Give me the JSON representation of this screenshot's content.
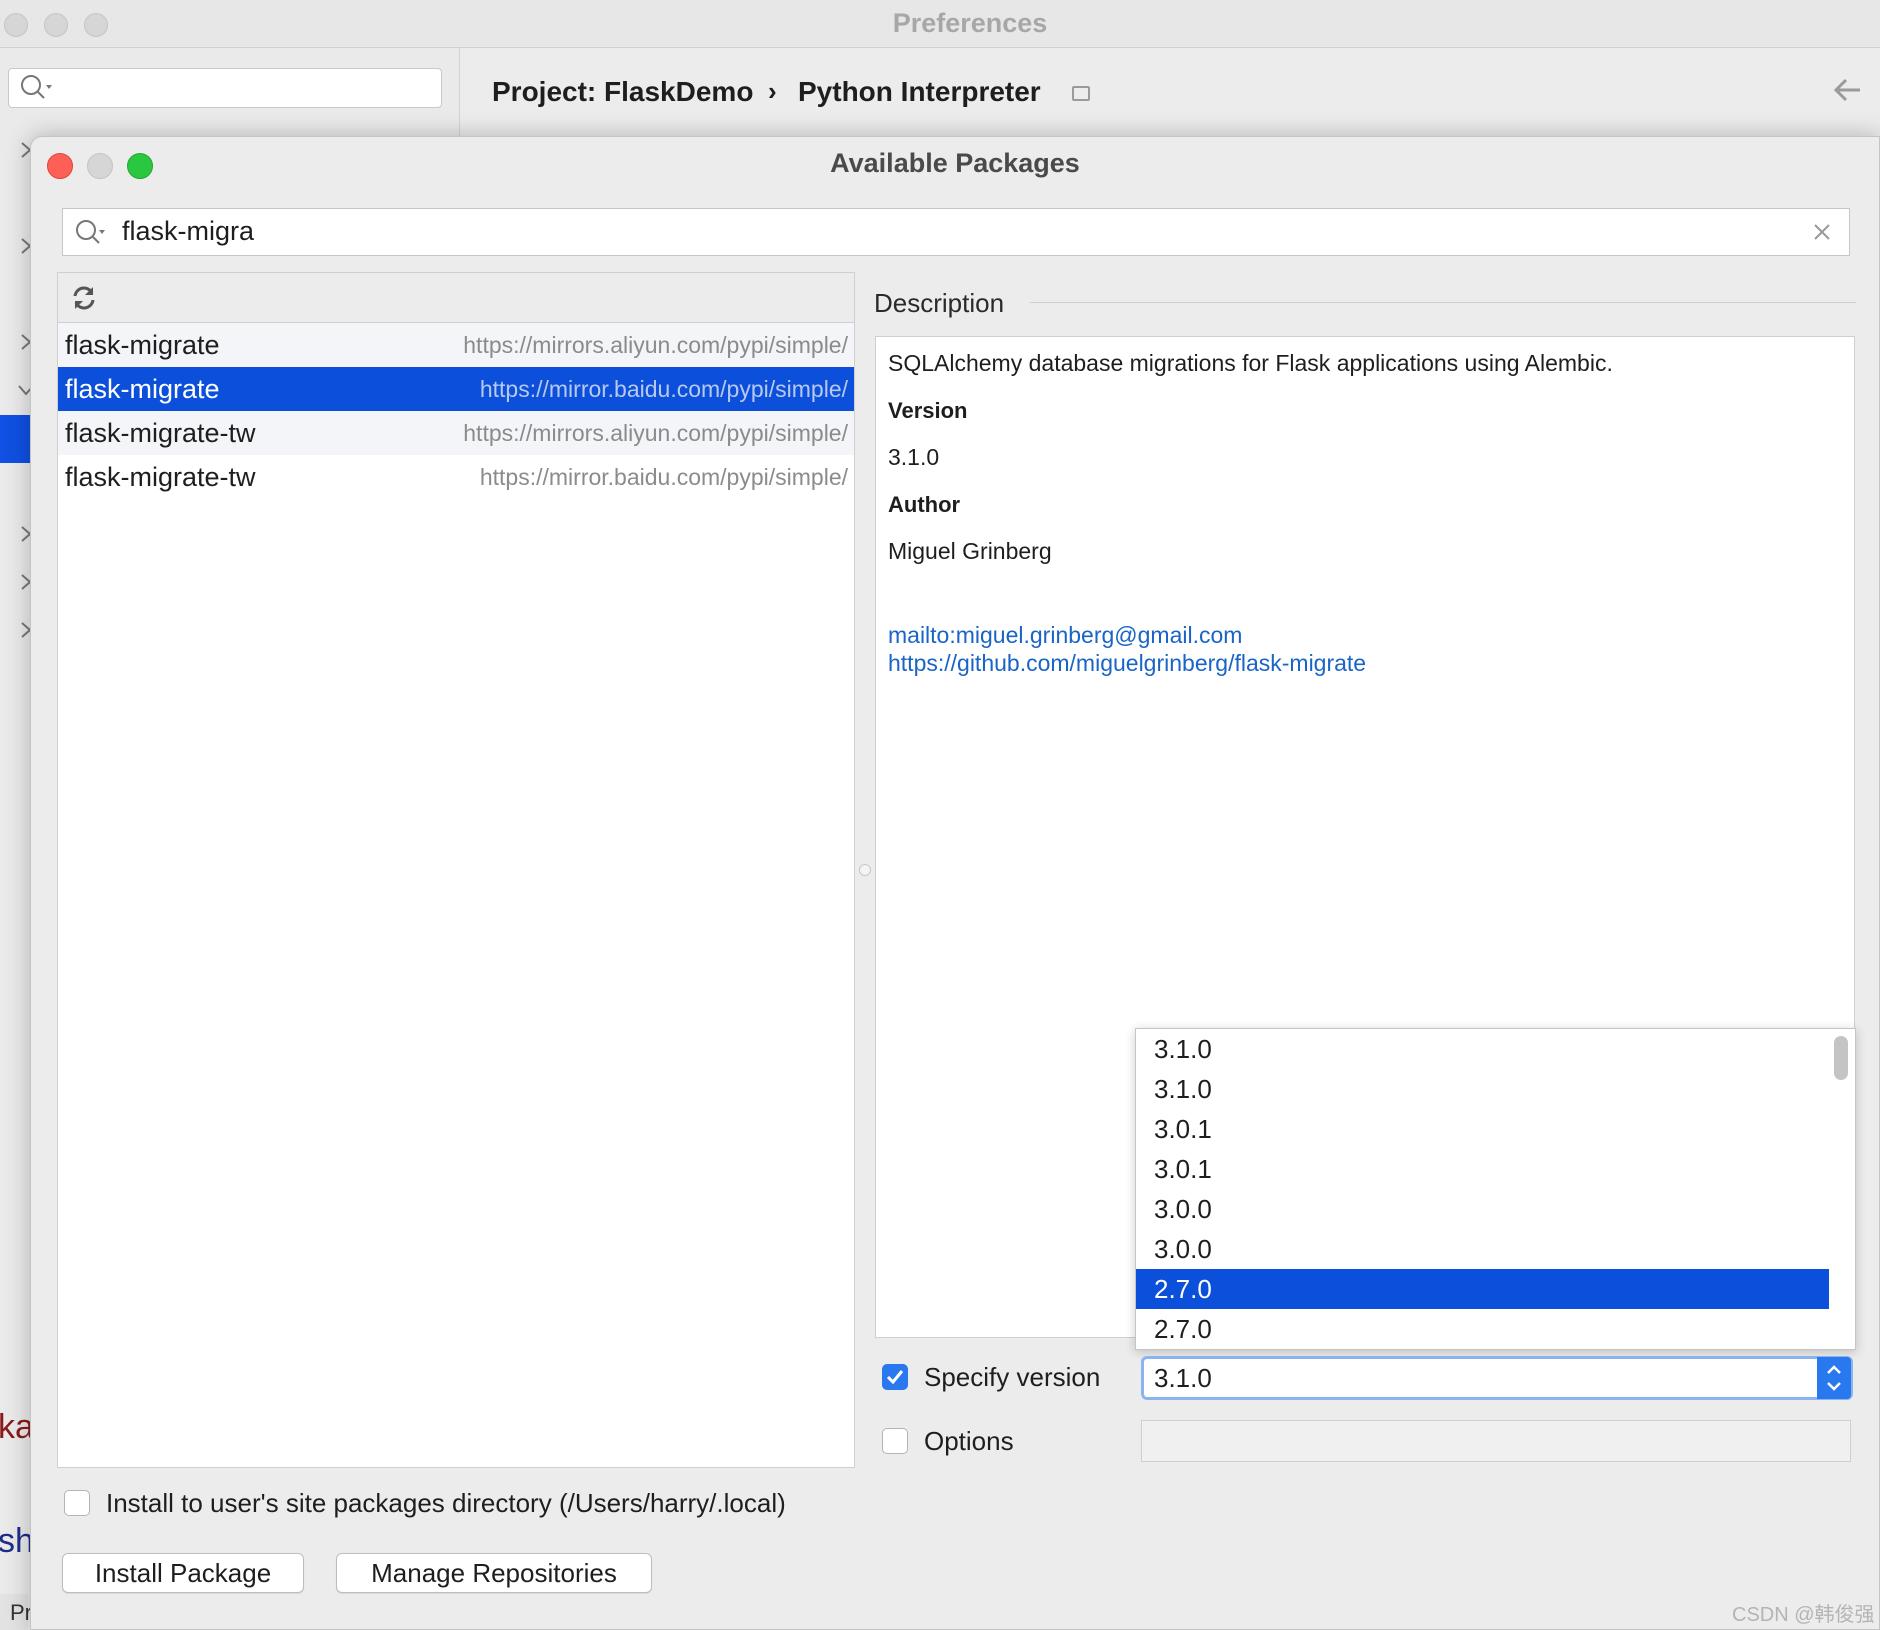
{
  "preferences": {
    "title": "Preferences",
    "breadcrumb_project": "Project: FlaskDemo",
    "breadcrumb_separator": "›",
    "breadcrumb_page": "Python Interpreter"
  },
  "dialog": {
    "title": "Available Packages",
    "search_value": "flask-migra"
  },
  "packages": [
    {
      "name": "flask-migrate",
      "url": "https://mirrors.aliyun.com/pypi/simple/"
    },
    {
      "name": "flask-migrate",
      "url": "https://mirror.baidu.com/pypi/simple/"
    },
    {
      "name": "flask-migrate-tw",
      "url": "https://mirrors.aliyun.com/pypi/simple/"
    },
    {
      "name": "flask-migrate-tw",
      "url": "https://mirror.baidu.com/pypi/simple/"
    }
  ],
  "selected_package_index": 1,
  "description": {
    "label": "Description",
    "summary": "SQLAlchemy database migrations for Flask applications using Alembic.",
    "version_label": "Version",
    "version": "3.1.0",
    "author_label": "Author",
    "author": "Miguel Grinberg",
    "link_email": "mailto:miguel.grinberg@gmail.com",
    "link_repo": "https://github.com/miguelgrinberg/flask-migrate"
  },
  "version_options": [
    "3.1.0",
    "3.1.0",
    "3.0.1",
    "3.0.1",
    "3.0.0",
    "3.0.0",
    "2.7.0",
    "2.7.0"
  ],
  "highlighted_version_index": 6,
  "specify_version": {
    "label": "Specify version",
    "checked": true,
    "selected_value": "3.1.0"
  },
  "options": {
    "label": "Options",
    "checked": false
  },
  "install_to_user": {
    "label": "Install to user's site packages directory (/Users/harry/.local)",
    "checked": false
  },
  "buttons": {
    "install": "Install Package",
    "manage": "Manage Repositories"
  },
  "background_text": {
    "red": "kag",
    "blue": "sh",
    "status": "Pr"
  },
  "watermark": "CSDN @韩俊强",
  "colors": {
    "selection": "#0b4fdb",
    "link": "#1a64c8",
    "checkbox_accent": "#2a78f0",
    "close": "#fe5f57",
    "zoom": "#2ac840"
  }
}
